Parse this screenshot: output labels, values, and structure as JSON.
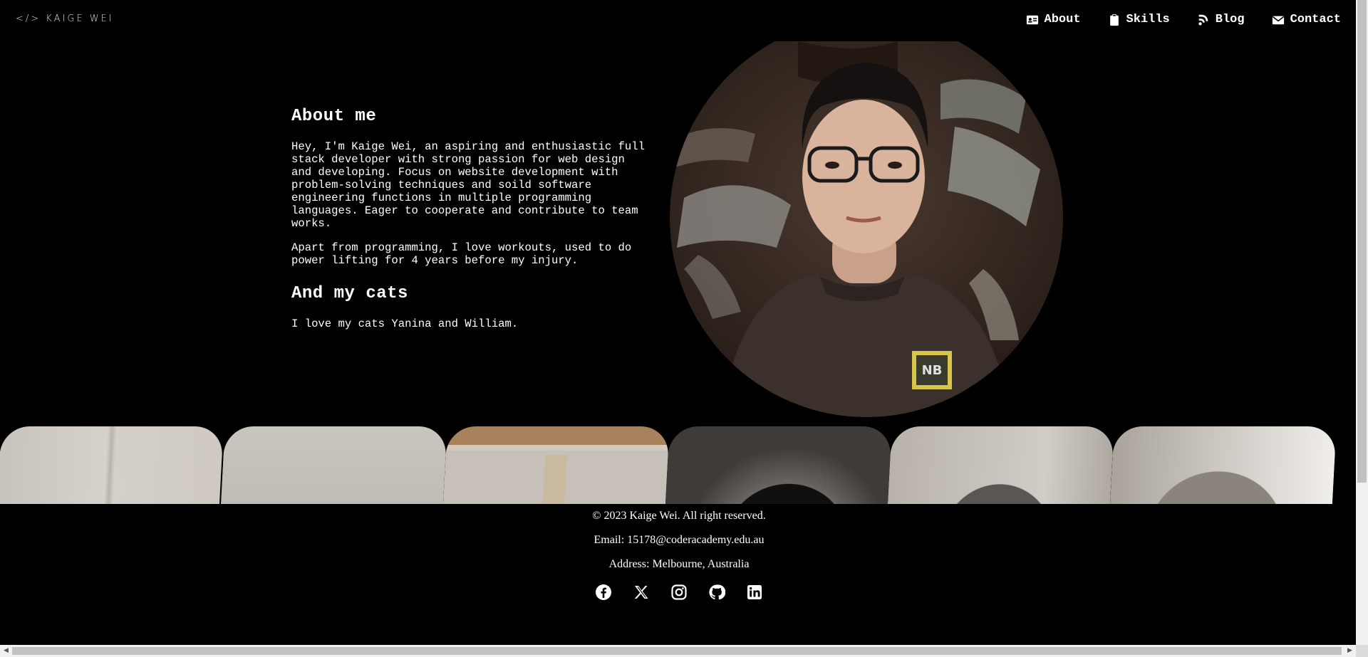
{
  "header": {
    "logo": "</> KAIGE WEI",
    "nav": [
      {
        "label": "About",
        "icon": "id-card-icon"
      },
      {
        "label": "Skills",
        "icon": "clipboard-icon"
      },
      {
        "label": "Blog",
        "icon": "blog-icon"
      },
      {
        "label": "Contact",
        "icon": "envelope-icon"
      }
    ]
  },
  "about": {
    "title": "About me",
    "intro": "Hey, I'm Kaige Wei, an aspiring and enthusiastic full stack developer with strong passion for web design and developing. Focus on website development with problem-solving techniques and soild software engineering functions in multiple programming languages. Eager to cooperate and contribute to team works.",
    "hobby": "Apart from programming, I love workouts, used to do power lifting for 4 years before my injury.",
    "cats_title": "And my cats",
    "cats_text": "I love my cats Yanina and William."
  },
  "footer": {
    "copyright": "© 2023 Kaige Wei. All right reserved.",
    "email": "Email: 15178@coderacademy.edu.au",
    "address": "Address: Melbourne, Australia",
    "socials": [
      "facebook-icon",
      "x-icon",
      "instagram-icon",
      "github-icon",
      "linkedin-icon"
    ]
  }
}
